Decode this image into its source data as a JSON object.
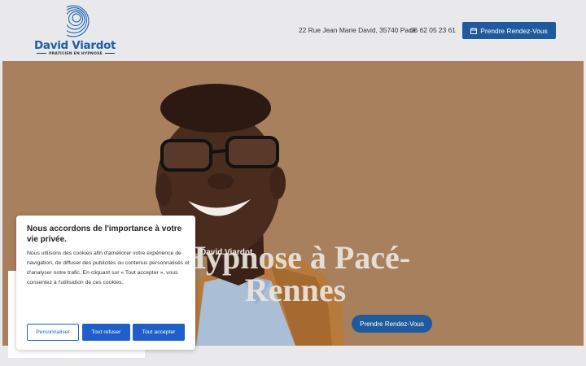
{
  "header": {
    "logo": {
      "name": "David Viardot",
      "tagline": "PRATICIEN EN HYPNOSE"
    },
    "address": "22 Rue Jean Marie David, 35740 Pacé",
    "phone": "06 62 05 23 61",
    "cta_label": "Prendre Rendez-Vous"
  },
  "hero": {
    "subtitle": "David Viardot",
    "title": "Hypnose à Pacé-Rennes",
    "cta_label": "Prendre Rendez-Vous"
  },
  "cookie_banner": {
    "title": "Nous accordons de l'importance à votre vie privée.",
    "text": "Nous utilisons des cookies afin d'améliorer votre expérience de navigation, de diffuser des publicités ou contenus personnalisés et d'analyser notre trafic. En cliquant sur « Tout accepter », vous consentez à l'utilisation de ces cookies.",
    "customize_label": "Personnaliser",
    "reject_label": "Tout refuser",
    "accept_label": "Tout accepter"
  },
  "colors": {
    "brand_blue": "#1f5a9c",
    "cookie_blue": "#1f5fc8",
    "hero_background": "#a9805e"
  },
  "icons": [
    "calendar-icon"
  ]
}
